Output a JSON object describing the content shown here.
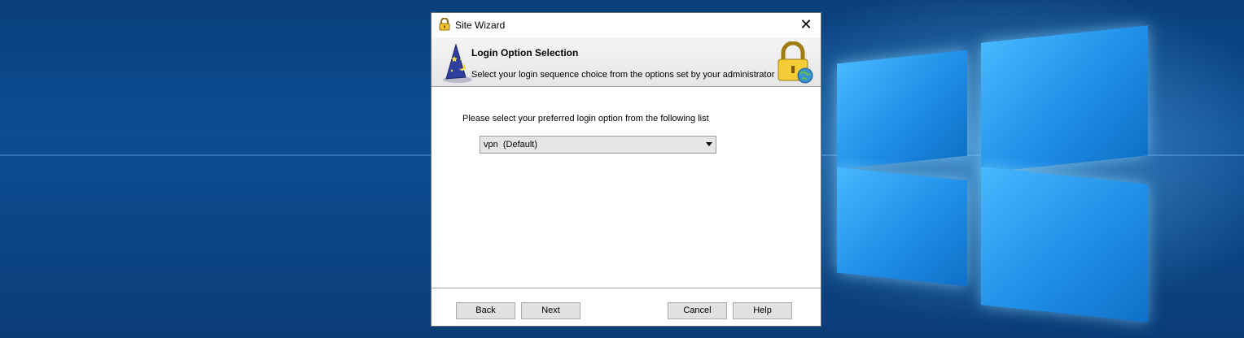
{
  "window": {
    "title": "Site Wizard",
    "close_glyph": "✕"
  },
  "header": {
    "title": "Login Option Selection",
    "subtitle": "Select your login sequence choice from the options set by your administrator",
    "left_icon": "wizard-hat-icon",
    "right_icon": "lock-globe-icon"
  },
  "body": {
    "prompt": "Please select your preferred  login option from the following list",
    "login_option": {
      "selected": "vpn  (Default)"
    }
  },
  "buttons": {
    "back": "Back",
    "next": "Next",
    "cancel": "Cancel",
    "help": "Help"
  },
  "colors": {
    "desktop_bg": "#0c4d93",
    "windows_logo": "#48b8ff"
  }
}
